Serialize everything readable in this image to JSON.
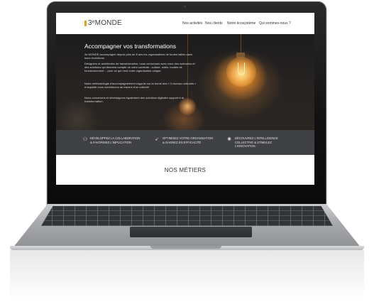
{
  "site": {
    "logo": "3ᵉMONDE",
    "nav": [
      "Nos activités",
      "Nos clients",
      "Notre écosystème",
      "Qui sommes-nous ?"
    ]
  },
  "hero": {
    "title": "Accompagner vos transformations",
    "paragraphs": [
      "3e MONDE accompagne depuis plus de 8 ans les organisations de toutes tailles dans leurs évolutions.",
      "Designers et architectes de transformation, nous concevons avec vous des scénarios et des solutions qui tiennent compte de votre contexte : culture, outils, modes de fonctionnement… pour ce qui rend votre organisation unique.",
      "Notre méthodologie d'accompagnement s'appuie sur la forme des « 3 niveaux culturels » à laquelle nous contribuons au travers d'un collectif.",
      "Nous concevons et développons également des solutions digitales support à la transformation."
    ]
  },
  "features": [
    {
      "icon": "people-icon",
      "text": "DÉVELOPPEZ LA COLLABORATION\n& FAVORISEZ L'IMPLICATION"
    },
    {
      "icon": "rocket-icon",
      "text": "OPTIMISEZ VOTRE ORGANISATION\n& GAGNEZ EN EFFICACITÉ"
    },
    {
      "icon": "brain-icon",
      "text": "DÉCOUVREZ L'INTELLIGENCE\nCOLLECTIVE & STIMULEZ\nL'INNOVATION"
    }
  ],
  "section": {
    "title": "NOS MÉTIERS"
  },
  "colors": {
    "accent": "#e7a11c",
    "band": "#3f4144",
    "hero_bg": "#1c1c1c"
  }
}
